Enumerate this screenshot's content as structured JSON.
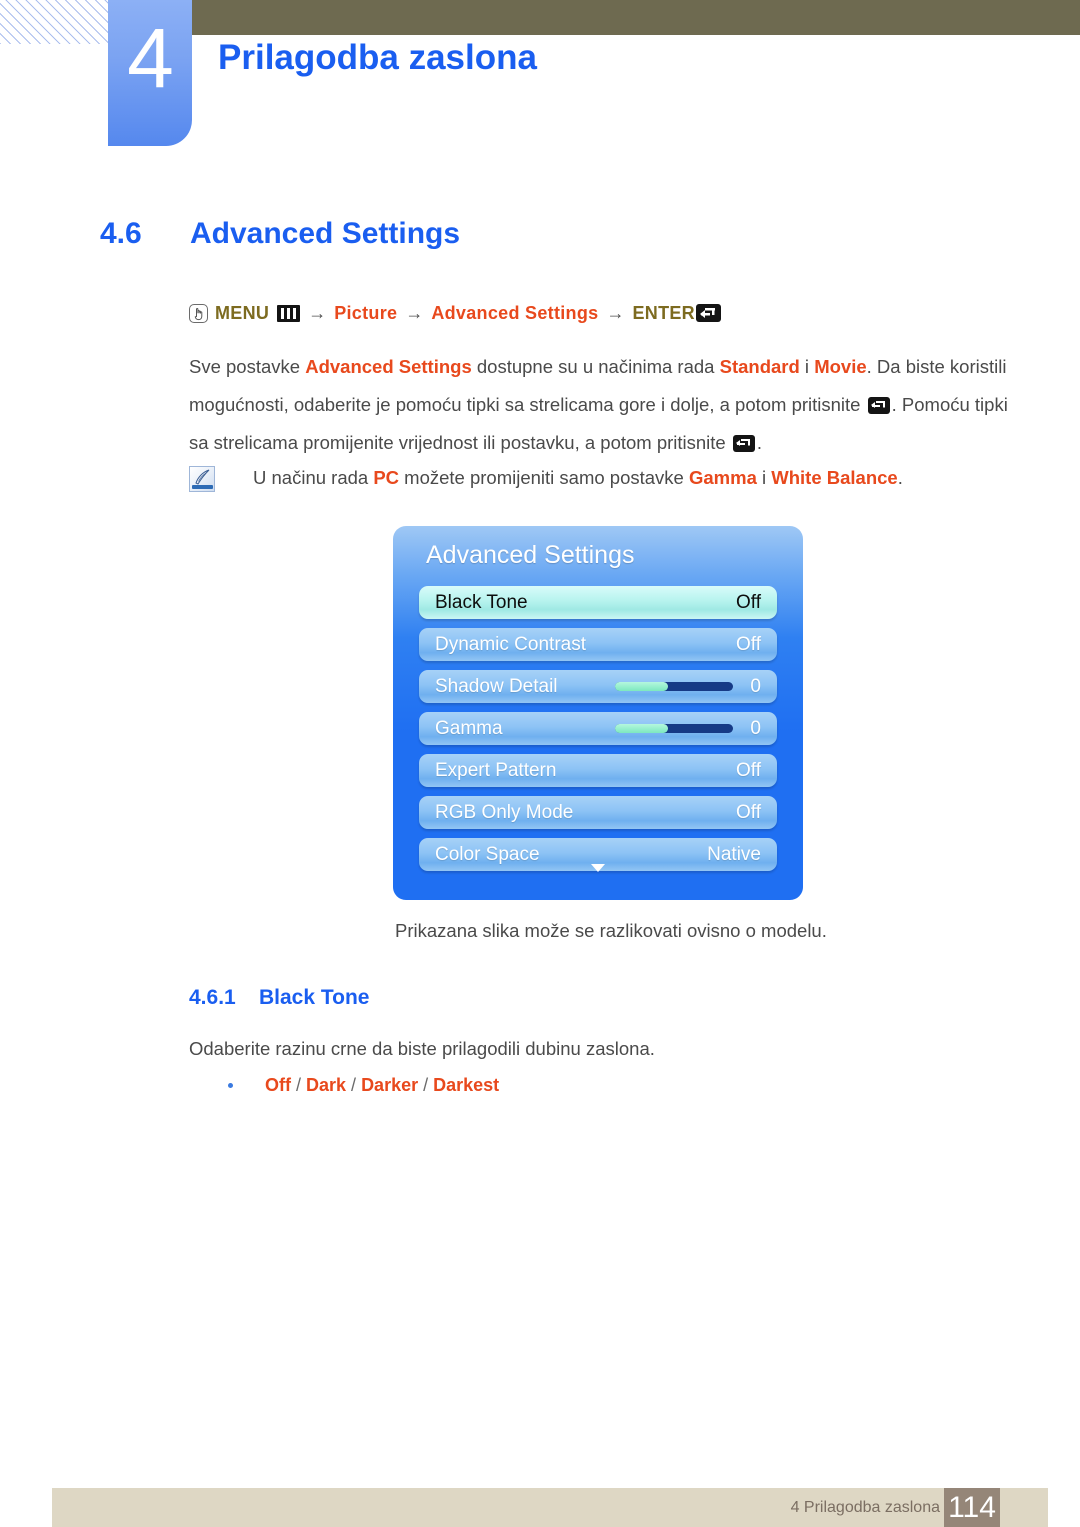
{
  "header": {
    "chapter_number": "4",
    "chapter_title": "Prilagodba zaslona",
    "topbar_color": "#6e6a50",
    "tab_color": "#5588ee"
  },
  "section": {
    "number": "4.6",
    "title": "Advanced Settings",
    "heading_color": "#1a5ef0"
  },
  "menu_path": {
    "hand_icon": "hand-press-icon",
    "menu_label": "MENU",
    "menu_icon": "menu-bars-icon",
    "arrow1": "→",
    "picture_label": "Picture",
    "arrow2": "→",
    "advanced_label": "Advanced Settings",
    "arrow3": "→",
    "enter_label": "ENTER",
    "enter_icon": "enter-key-icon",
    "gold_color": "#7d6b20",
    "orange_color": "#e8491d"
  },
  "body": {
    "p1_a": "Sve postavke ",
    "p1_b1": "Advanced Settings",
    "p1_c": " dostupne su u načinima rada ",
    "p1_b2": "Standard",
    "p1_d": " i ",
    "p1_b3": "Movie",
    "p1_e": ". Da biste koristili mogućnosti, odaberite je pomoću tipki sa strelicama gore i dolje, a potom pritisnite ",
    "p1_f": ". Pomoću tipki sa strelicama promijenite vrijednost ili postavku, a potom pritisnite ",
    "p1_g": "."
  },
  "note": {
    "icon": "note-quill-icon",
    "t1": "U načinu rada ",
    "b1": "PC",
    "t2": " možete promijeniti samo postavke ",
    "b2": "Gamma",
    "t3": " i ",
    "b3": "White Balance",
    "t4": "."
  },
  "osd": {
    "title": "Advanced Settings",
    "rows": [
      {
        "label": "Black Tone",
        "value": "Off",
        "selected": true,
        "slider": null
      },
      {
        "label": "Dynamic Contrast",
        "value": "Off",
        "selected": false,
        "slider": null
      },
      {
        "label": "Shadow Detail",
        "value": "0",
        "selected": false,
        "slider": 45
      },
      {
        "label": "Gamma",
        "value": "0",
        "selected": false,
        "slider": 45
      },
      {
        "label": "Expert Pattern",
        "value": "Off",
        "selected": false,
        "slider": null
      },
      {
        "label": "RGB Only Mode",
        "value": "Off",
        "selected": false,
        "slider": null
      },
      {
        "label": "Color Space",
        "value": "Native",
        "selected": false,
        "slider": null
      }
    ],
    "more_indicator": "chevron-down-icon",
    "caption": "Prikazana slika može se razlikovati ovisno o modelu."
  },
  "subsection": {
    "number": "4.6.1",
    "title": "Black Tone",
    "paragraph": "Odaberite razinu crne da biste prilagodili dubinu zaslona.",
    "options": [
      "Off",
      "Dark",
      "Darker",
      "Darkest"
    ],
    "separator": " / "
  },
  "footer": {
    "text": "4 Prilagodba zaslona",
    "page": "114",
    "bar_color": "#ded7c4",
    "page_box_color": "#958678"
  }
}
